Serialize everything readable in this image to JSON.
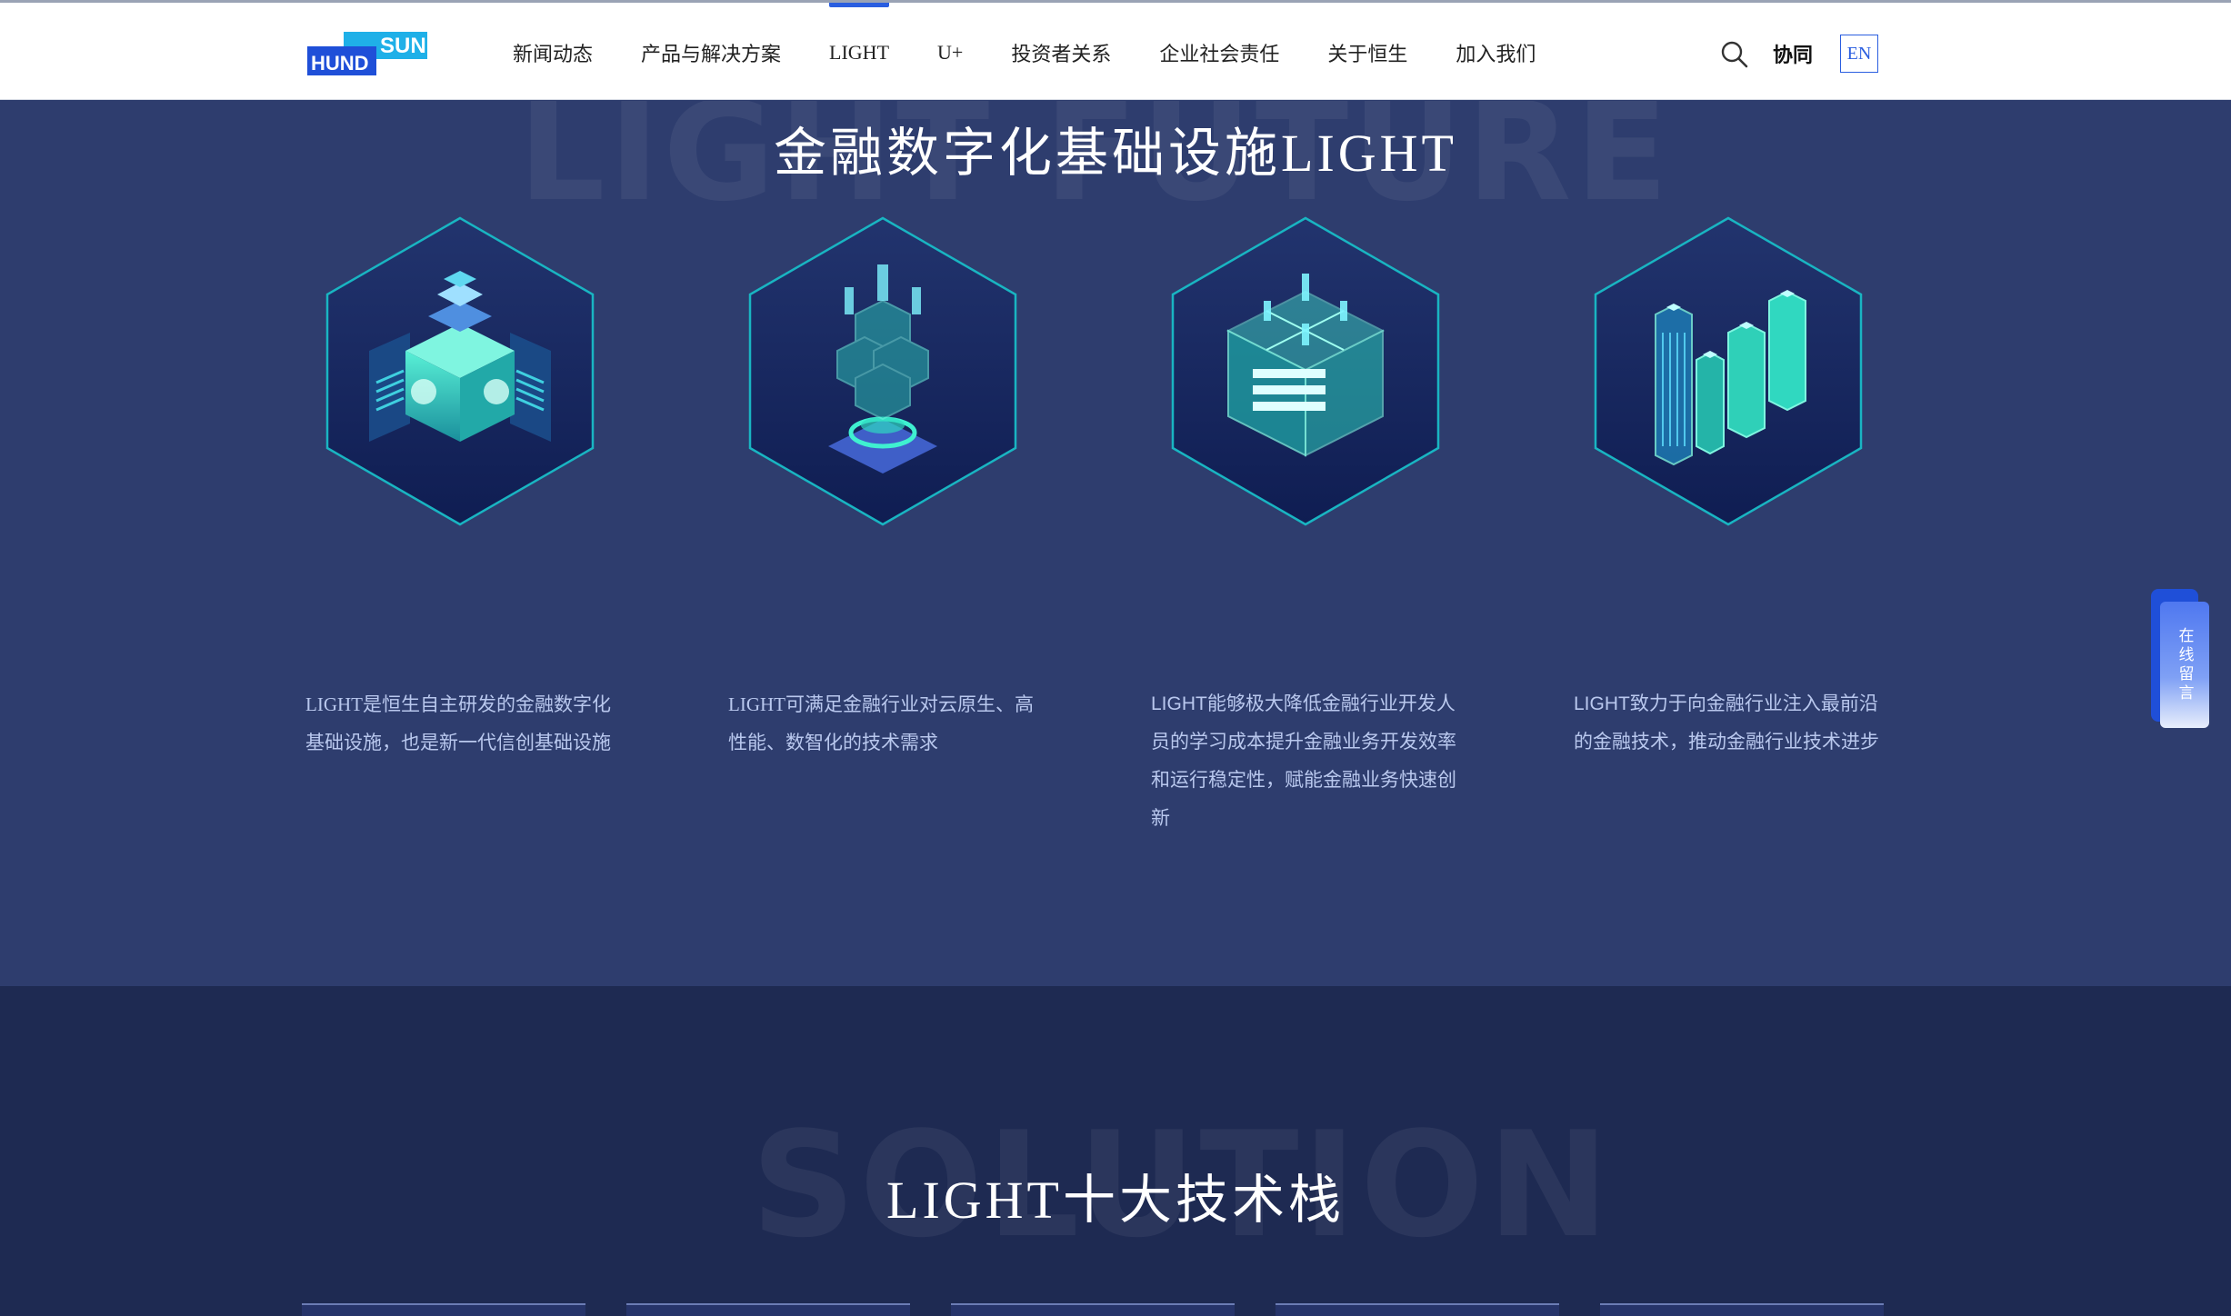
{
  "header": {
    "logo": {
      "top_text": "SUN",
      "bottom_text": "HUND",
      "colors": {
        "blue": "#1f4fd8",
        "cyan": "#1fb0e8"
      }
    },
    "nav": [
      {
        "label": "新闻动态"
      },
      {
        "label": "产品与解决方案"
      },
      {
        "label": "LIGHT",
        "active": true
      },
      {
        "label": "U+"
      },
      {
        "label": "投资者关系"
      },
      {
        "label": "企业社会责任"
      },
      {
        "label": "关于恒生"
      },
      {
        "label": "加入我们"
      }
    ],
    "search_icon": "search-icon",
    "cooperate": "协同",
    "lang": "EN"
  },
  "section1": {
    "background_word": "LIGHT FUTURE",
    "title": "金融数字化基础设施LIGHT",
    "features": [
      {
        "icon": "cube-module-icon",
        "text": "LIGHT是恒生自主研发的金融数字化基础设施，也是新一代信创基础设施"
      },
      {
        "icon": "cloud-stack-icon",
        "text": "LIGHT可满足金融行业对云原生、高性能、数智化的技术需求"
      },
      {
        "icon": "data-block-icon",
        "text": "LIGHT能够极大降低金融行业开发人员的学习成本提升金融业务开发效率和运行稳定性，赋能金融业务快速创新"
      },
      {
        "icon": "building-towers-icon",
        "text": "LIGHT致力于向金融行业注入最前沿的金融技术，推动金融行业技术进步"
      }
    ]
  },
  "float_tab": {
    "label": "在线留言"
  },
  "section2": {
    "background_word": "SOLUTION",
    "title": "LIGHT十大技术栈",
    "cards": 5
  },
  "colors": {
    "section1_bg": "#2e3d6e",
    "section2_bg": "#1e2a52",
    "accent": "#2a5ee0",
    "teal": "#2fe0c0"
  }
}
